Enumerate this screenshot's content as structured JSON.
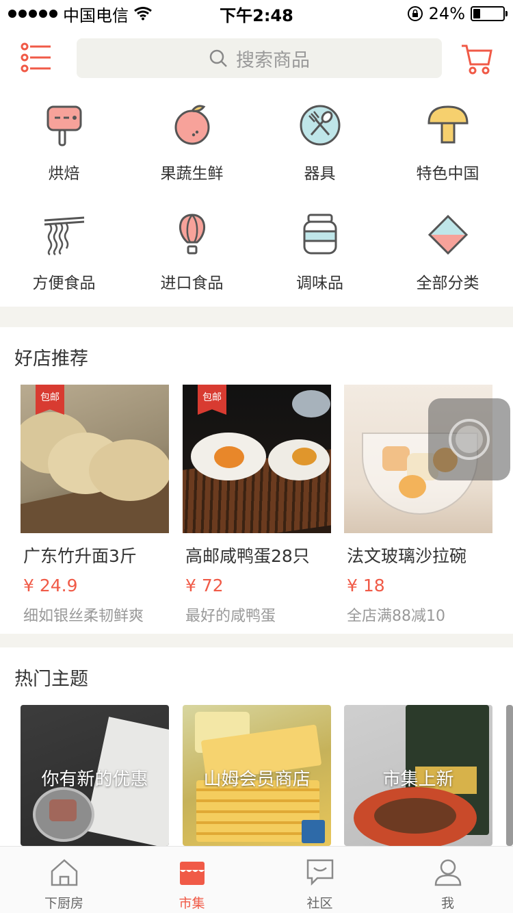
{
  "status_bar": {
    "carrier": "中国电信",
    "time": "下午2:48",
    "battery": "24%",
    "battery_level": 0.24
  },
  "header": {
    "menu_icon": "list-icon",
    "search_placeholder": "搜索商品",
    "cart_icon": "cart-icon",
    "accent_color": "#f05a47"
  },
  "categories": [
    {
      "label": "烘焙",
      "icon": "mixer-icon"
    },
    {
      "label": "果蔬生鲜",
      "icon": "fruit-icon"
    },
    {
      "label": "器具",
      "icon": "utensils-icon"
    },
    {
      "label": "特色中国",
      "icon": "mushroom-icon"
    },
    {
      "label": "方便食品",
      "icon": "noodles-icon"
    },
    {
      "label": "进口食品",
      "icon": "balloon-icon"
    },
    {
      "label": "调味品",
      "icon": "jar-icon"
    },
    {
      "label": "全部分类",
      "icon": "diamond-icon"
    }
  ],
  "shops_section": {
    "title": "好店推荐",
    "items": [
      {
        "name": "广东竹升面3斤",
        "price": "¥ 24.9",
        "desc": "细如银丝柔韧鲜爽",
        "badge": "包邮"
      },
      {
        "name": "高邮咸鸭蛋28只",
        "price": "¥ 72",
        "desc": "最好的咸鸭蛋",
        "badge": "包邮"
      },
      {
        "name": "法文玻璃沙拉碗",
        "price": "¥ 18",
        "desc": "全店满88减10",
        "badge": ""
      }
    ]
  },
  "themes_section": {
    "title": "热门主题",
    "items": [
      {
        "title": "你有新的优惠"
      },
      {
        "title": "山姆会员商店"
      },
      {
        "title": "市集上新"
      }
    ]
  },
  "tabbar": {
    "items": [
      {
        "label": "下厨房",
        "icon": "home-icon",
        "active": false
      },
      {
        "label": "市集",
        "icon": "market-icon",
        "active": true
      },
      {
        "label": "社区",
        "icon": "chat-icon",
        "active": false
      },
      {
        "label": "我",
        "icon": "user-icon",
        "active": false
      }
    ]
  }
}
